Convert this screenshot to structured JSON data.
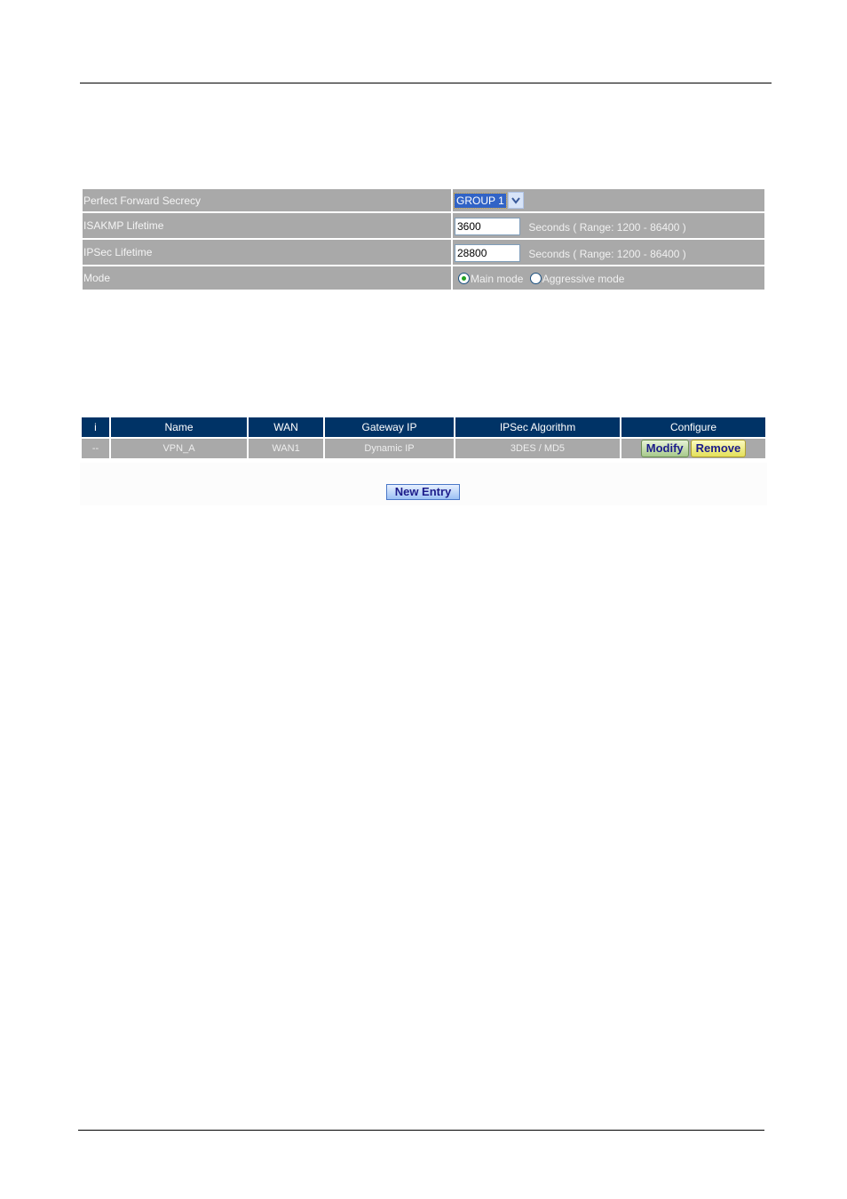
{
  "settings": {
    "rows": [
      {
        "label": "Perfect Forward Secrecy",
        "select_value": "GROUP 1"
      },
      {
        "label": "ISAKMP Lifetime",
        "input_value": "3600",
        "hint": "Seconds  ( Range: 1200 - 86400 )"
      },
      {
        "label": "IPSec Lifetime",
        "input_value": "28800",
        "hint": "Seconds  ( Range: 1200 - 86400 )"
      },
      {
        "label": "Mode",
        "options": [
          {
            "label": "Main mode",
            "checked": true
          },
          {
            "label": "Aggressive mode",
            "checked": false
          }
        ]
      }
    ]
  },
  "vpn_list": {
    "headers": [
      "i",
      "Name",
      "WAN",
      "Gateway IP",
      "IPSec Algorithm",
      "Configure"
    ],
    "rows": [
      {
        "index": "--",
        "name": "VPN_A",
        "wan": "WAN1",
        "gateway_ip": "Dynamic IP",
        "algorithm": "3DES / MD5",
        "modify_label": "Modify",
        "remove_label": "Remove"
      }
    ],
    "new_entry_label": "New  Entry"
  },
  "icons": {
    "dropdown": "chevron-down-icon"
  }
}
